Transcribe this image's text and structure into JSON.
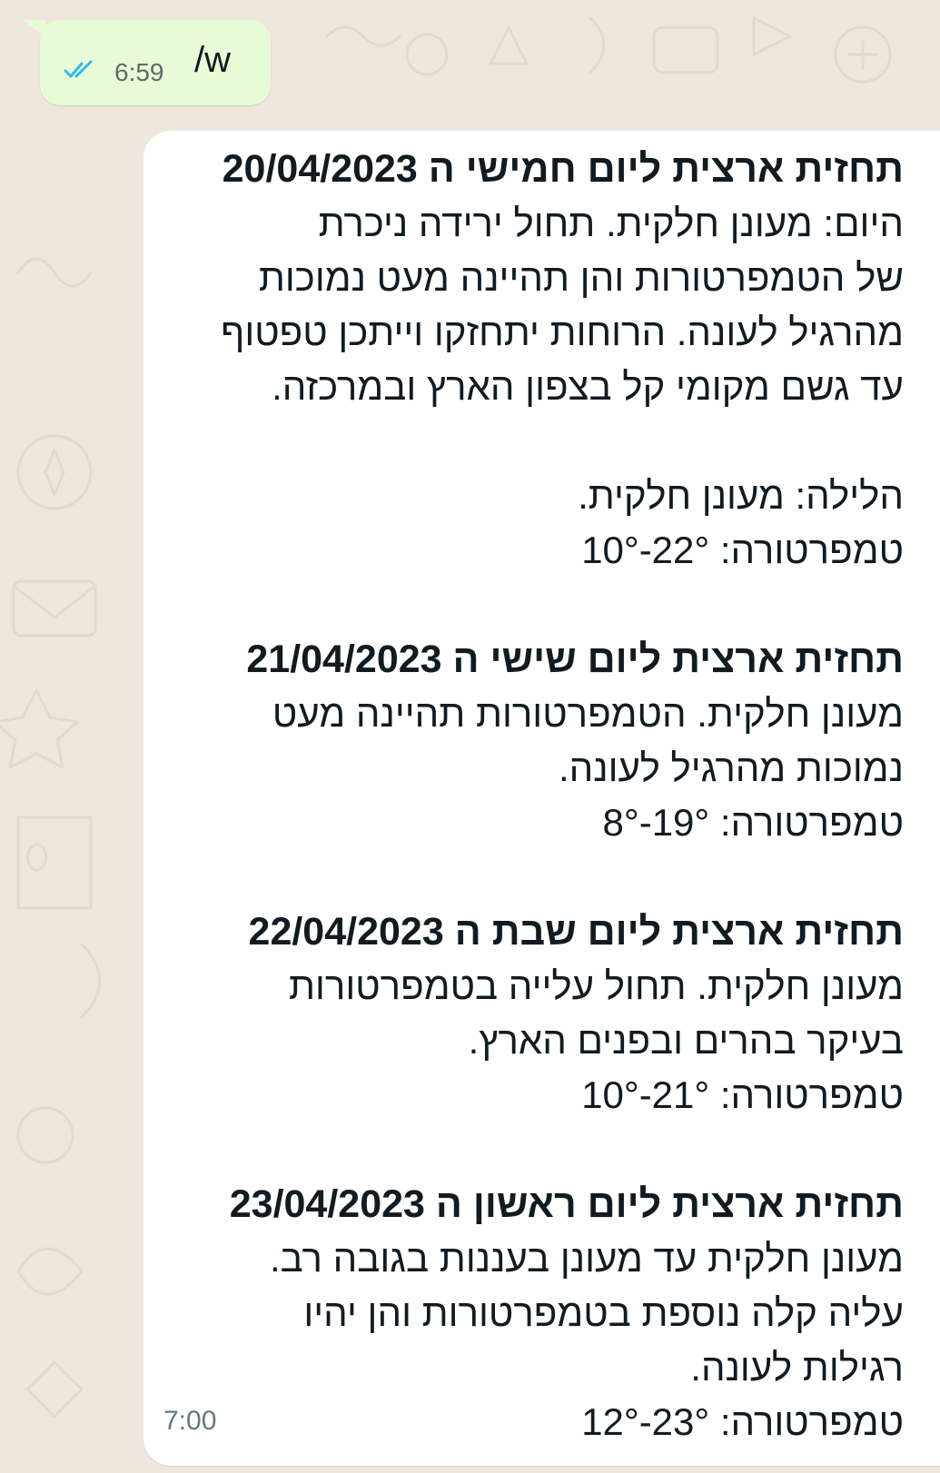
{
  "colors": {
    "wallpaper": "#efe7dd",
    "sent_bubble": "#e7fcd6",
    "received_bubble": "#ffffff",
    "read_ticks": "#34b7f1",
    "text": "#111b21",
    "timestamp": "#667781"
  },
  "sent_message": {
    "text": "/w",
    "time": "6:59",
    "status_icon": "double-check-read-icon"
  },
  "received_message": {
    "time": "7:00",
    "day1": {
      "title": "תחזית ארצית ליום חמישי ה 20/04/2023",
      "lines": [
        "היום: מעונן חלקית. תחול ירידה ניכרת",
        "של הטמפרטורות והן תהיינה מעט נמוכות",
        "מהרגיל לעונה. הרוחות יתחזקו וייתכן טפטוף",
        "עד גשם מקומי קל בצפון הארץ ובמרכזה."
      ],
      "night": "הלילה: מעונן חלקית.",
      "temp_label": "טמפרטורה:",
      "temp_value": "10°-22°"
    },
    "day2": {
      "title": "תחזית ארצית ליום שישי ה 21/04/2023",
      "lines": [
        "מעונן חלקית. הטמפרטורות תהיינה מעט",
        "נמוכות מהרגיל לעונה."
      ],
      "temp_label": "טמפרטורה:",
      "temp_value": "8°-19°"
    },
    "day3": {
      "title": "תחזית ארצית ליום שבת ה 22/04/2023",
      "lines": [
        "מעונן חלקית. תחול עלייה בטמפרטורות",
        "בעיקר בהרים ובפנים הארץ."
      ],
      "temp_label": "טמפרטורה:",
      "temp_value": "10°-21°"
    },
    "day4": {
      "title": "תחזית ארצית ליום ראשון ה 23/04/2023",
      "lines": [
        "מעונן חלקית עד מעונן בעננות בגובה רב.",
        "עליה קלה נוספת בטמפרטורות והן יהיו",
        "רגילות לעונה."
      ],
      "temp_label": "טמפרטורה:",
      "temp_value": "12°-23°"
    }
  }
}
